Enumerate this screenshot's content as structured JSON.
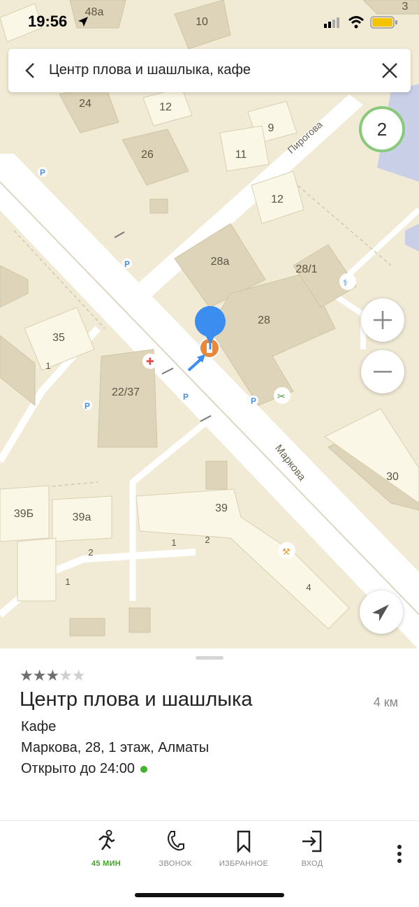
{
  "status_bar": {
    "time": "19:56"
  },
  "search": {
    "query": "Центр плова и шашлыка, кафе"
  },
  "map": {
    "traffic_level": "2",
    "streets": [
      "Пирогова",
      "Маркова"
    ],
    "buildings": [
      "48а",
      "10",
      "3",
      "24",
      "12",
      "9",
      "11",
      "26",
      "12",
      "28а",
      "28/1",
      "28",
      "35",
      "22/37",
      "30",
      "39Б",
      "39а",
      "39"
    ],
    "entrances": [
      "1",
      "1",
      "2",
      "2",
      "1",
      "4",
      "1"
    ]
  },
  "place": {
    "rating_stars_filled": 3,
    "rating_stars_total": 5,
    "rating_stars_on": "★★★",
    "rating_stars_off": "★★",
    "name": "Центр плова и шашлыка",
    "distance": "4 км",
    "category": "Кафе",
    "address": "Маркова, 28, 1 этаж, Алматы",
    "hours": "Открыто до 24:00"
  },
  "bottom_tabs": [
    {
      "label": "45 МИН",
      "icon": "walker-icon"
    },
    {
      "label": "ЗВОНОК",
      "icon": "phone-icon"
    },
    {
      "label": "ИЗБРАННОЕ",
      "icon": "bookmark-icon"
    },
    {
      "label": "ВХОД",
      "icon": "login-icon"
    }
  ],
  "colors": {
    "accent_green": "#43a22a",
    "pin_blue": "#3b8df0",
    "cafe_orange": "#e8893a",
    "open_dot": "#43b32d"
  }
}
